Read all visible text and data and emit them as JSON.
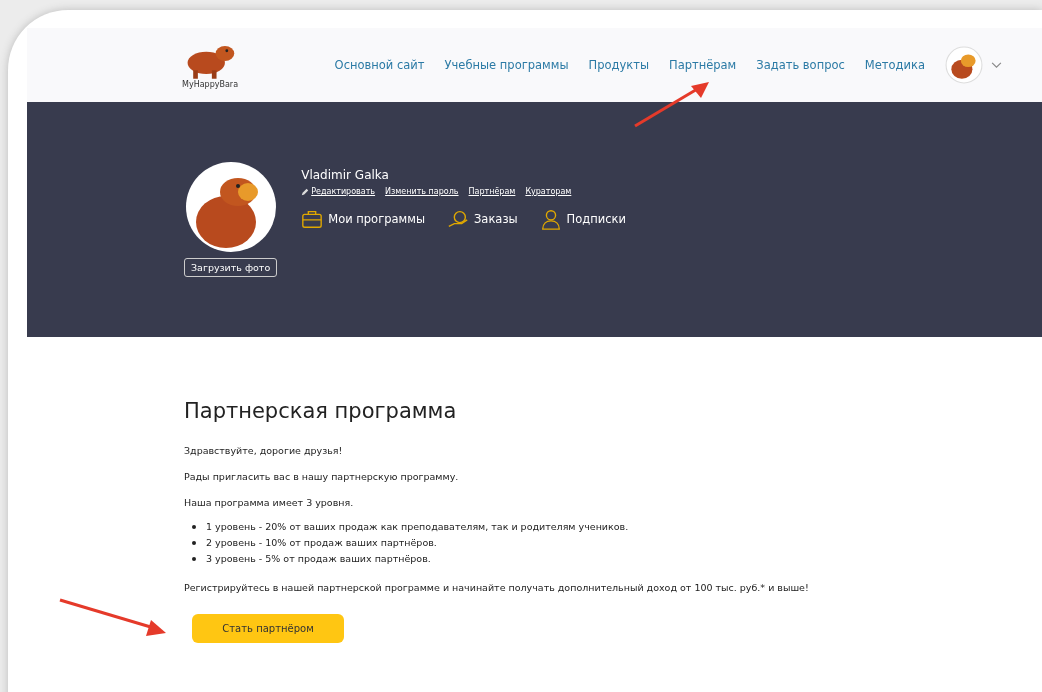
{
  "header": {
    "logo_text": "MyHappyBara",
    "nav": [
      "Основной сайт",
      "Учебные программы",
      "Продукты",
      "Партнёрам",
      "Задать вопрос",
      "Методика"
    ]
  },
  "profile": {
    "name": "Vladimir Galka",
    "upload_button": "Загрузить фото",
    "links": [
      {
        "kind": "edit",
        "label": "Редактировать"
      },
      {
        "kind": "plain",
        "label": "Изменить пароль"
      },
      {
        "kind": "plain",
        "label": "Партнёрам"
      },
      {
        "kind": "plain",
        "label": "Кураторам"
      }
    ],
    "sections": [
      {
        "kind": "briefcase",
        "label": "Мои программы"
      },
      {
        "kind": "money",
        "label": "Заказы"
      },
      {
        "kind": "person",
        "label": "Подписки"
      }
    ]
  },
  "content": {
    "title": "Партнерская программа",
    "paragraphs": [
      "Здравствуйте, дорогие друзья!",
      "Рады пригласить вас в нашу партнерскую программу.",
      "Наша программа имеет 3 уровня."
    ],
    "levels": [
      "1 уровень - 20% от ваших продаж как преподавателям, так и родителям учеников.",
      "2 уровень - 10% от продаж ваших партнёров.",
      "3 уровень - 5% от продаж ваших партнёров."
    ],
    "closing": "Регистрируйтесь в нашей партнерской программе и начинайте получать дополнительный доход от 100 тыс. руб.* и выше!",
    "button": "Стать партнёром"
  }
}
